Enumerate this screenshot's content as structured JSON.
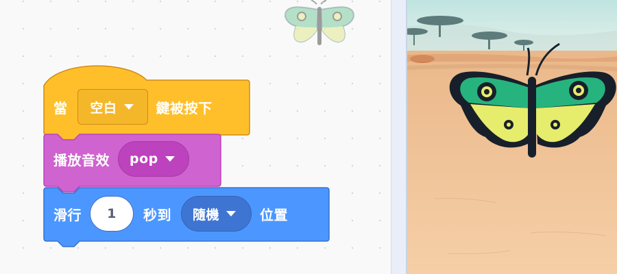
{
  "blocks": {
    "when_key": {
      "prefix": "當",
      "key": "空白",
      "suffix": "鍵被按下"
    },
    "play_sound": {
      "label": "播放音效",
      "sound": "pop"
    },
    "glide": {
      "prefix": "滑行",
      "seconds": "1",
      "middle": "秒到",
      "target": "隨機",
      "suffix": "位置"
    }
  },
  "colors": {
    "events": "#ffbf2b",
    "sound": "#cf63cf",
    "motion": "#4c97ff",
    "stage_ground": "#f2c59c",
    "butterfly_green": "#27b37e",
    "butterfly_yellow": "#e6ec6c"
  },
  "icons": {
    "caret": "triangle-down",
    "sprite": "butterfly"
  }
}
